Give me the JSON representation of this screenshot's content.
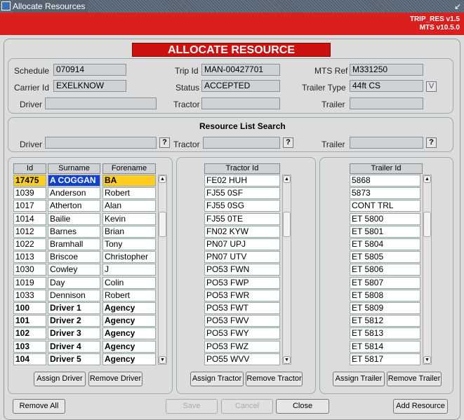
{
  "window": {
    "title": "Allocate Resources",
    "close_glyph": "↙"
  },
  "version": {
    "app": "TRIP_RES v1.5",
    "system": "MTS v10.5.0"
  },
  "banner": "ALLOCATE RESOURCE",
  "details": {
    "schedule_label": "Schedule",
    "schedule": "070914",
    "trip_id_label": "Trip Id",
    "trip_id": "MAN-00427701",
    "mts_ref_label": "MTS Ref",
    "mts_ref": "M331250",
    "carrier_id_label": "Carrier Id",
    "carrier_id": "EXELKNOW",
    "status_label": "Status",
    "status": "ACCEPTED",
    "trailer_type_label": "Trailer Type",
    "trailer_type": "44ft CS",
    "trailer_type_btn": "V",
    "driver_label": "Driver",
    "driver": "",
    "tractor_label": "Tractor",
    "tractor": "",
    "trailer_label": "Trailer",
    "trailer": ""
  },
  "search": {
    "title": "Resource List Search",
    "driver_label": "Driver",
    "driver": "",
    "tractor_label": "Tractor",
    "tractor": "",
    "trailer_label": "Trailer",
    "trailer": "",
    "lov_btn": "?"
  },
  "drivers": {
    "headers": [
      "Id",
      "Surname",
      "Forename"
    ],
    "rows": [
      [
        "17475",
        "A COGGAN",
        "BA"
      ],
      [
        "1039",
        "Anderson",
        "Robert"
      ],
      [
        "1017",
        "Atherton",
        "Alan"
      ],
      [
        "1014",
        "Bailie",
        "Kevin"
      ],
      [
        "1012",
        "Barnes",
        "Brian"
      ],
      [
        "1022",
        "Bramhall",
        "Tony"
      ],
      [
        "1013",
        "Briscoe",
        "Christopher"
      ],
      [
        "1030",
        "Cowley",
        "J"
      ],
      [
        "1019",
        "Day",
        "Colin"
      ],
      [
        "1033",
        "Dennison",
        "Robert"
      ],
      [
        "100",
        "Driver 1",
        "Agency"
      ],
      [
        "101",
        "Driver 2",
        "Agency"
      ],
      [
        "102",
        "Driver 3",
        "Agency"
      ],
      [
        "103",
        "Driver 4",
        "Agency"
      ],
      [
        "104",
        "Driver 5",
        "Agency"
      ]
    ],
    "assign": "Assign Driver",
    "remove": "Remove Driver"
  },
  "tractors": {
    "header": "Tractor Id",
    "rows": [
      "FE02 HUH",
      "FJ55 0SF",
      "FJ55 0SG",
      "FJ55 0TE",
      "FN02 KYW",
      "PN07 UPJ",
      "PN07 UTV",
      "PO53 FWN",
      "PO53 FWP",
      "PO53 FWR",
      "PO53 FWT",
      "PO53 FWV",
      "PO53 FWY",
      "PO53 FWZ",
      "PO55 WVV"
    ],
    "assign": "Assign Tractor",
    "remove": "Remove Tractor"
  },
  "trailers": {
    "header": "Trailer Id",
    "rows": [
      "5868",
      "5873",
      "CONT TRL",
      "ET 5800",
      "ET 5801",
      "ET 5804",
      "ET 5805",
      "ET 5806",
      "ET 5807",
      "ET 5808",
      "ET 5809",
      "ET 5812",
      "ET 5813",
      "ET 5814",
      "ET 5817"
    ],
    "assign": "Assign Trailer",
    "remove": "Remove Trailer"
  },
  "footer": {
    "remove_all": "Remove All",
    "save": "Save",
    "cancel": "Cancel",
    "close": "Close",
    "add_resource": "Add Resource"
  }
}
